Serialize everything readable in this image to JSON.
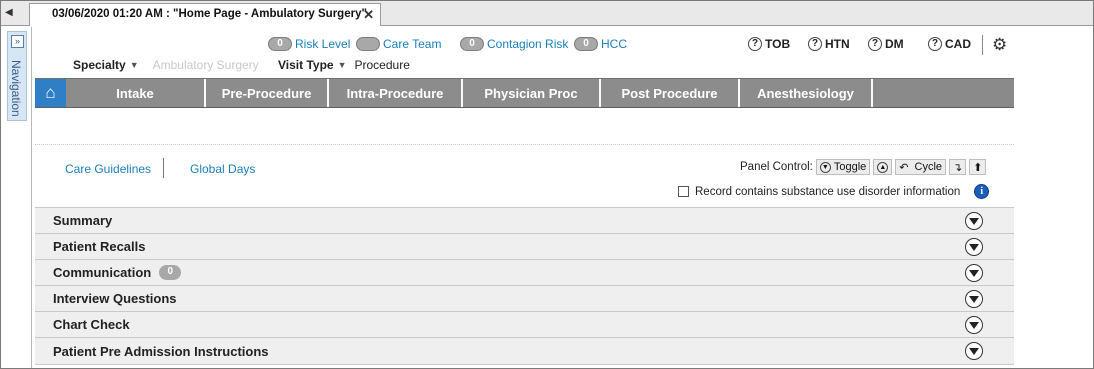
{
  "tab": {
    "title": "03/06/2020 01:20 AM : \"Home Page - Ambulatory Surgery\"",
    "close": "✕",
    "scroll_left": "◀"
  },
  "navigation": {
    "label": "Navigation",
    "expand": "»"
  },
  "flags": [
    {
      "count": "0",
      "label": "Risk Level"
    },
    {
      "count": "",
      "label": "Care Team"
    },
    {
      "count": "0",
      "label": "Contagion Risk"
    },
    {
      "count": "0",
      "label": "HCC"
    }
  ],
  "dx_flags": [
    {
      "icon": "?",
      "label": "TOB"
    },
    {
      "icon": "?",
      "label": "HTN"
    },
    {
      "icon": "?",
      "label": "DM"
    },
    {
      "icon": "?",
      "label": "CAD"
    }
  ],
  "settings_icon": "⚙",
  "specialty": {
    "label": "Specialty",
    "value": "Ambulatory Surgery"
  },
  "visit_type": {
    "label": "Visit Type",
    "value": "Procedure"
  },
  "workflow": {
    "home_icon": "⌂",
    "tabs": [
      "Intake",
      "Pre-Procedure",
      "Intra-Procedure",
      "Physician Proc",
      "Post Procedure",
      "Anesthesiology"
    ]
  },
  "sublinks": {
    "care_guidelines": "Care Guidelines",
    "global_days": "Global Days"
  },
  "panel_control": {
    "label": "Panel Control:",
    "toggle": "Toggle",
    "cycle": "Cycle"
  },
  "substance": {
    "label": "Record contains substance use disorder information",
    "info": "i"
  },
  "components": [
    {
      "label": "Summary",
      "badge": ""
    },
    {
      "label": "Patient Recalls",
      "badge": ""
    },
    {
      "label": "Communication",
      "badge": "0"
    },
    {
      "label": "Interview Questions",
      "badge": ""
    },
    {
      "label": "Chart Check",
      "badge": ""
    },
    {
      "label": "Patient Pre Admission Instructions",
      "badge": ""
    }
  ]
}
